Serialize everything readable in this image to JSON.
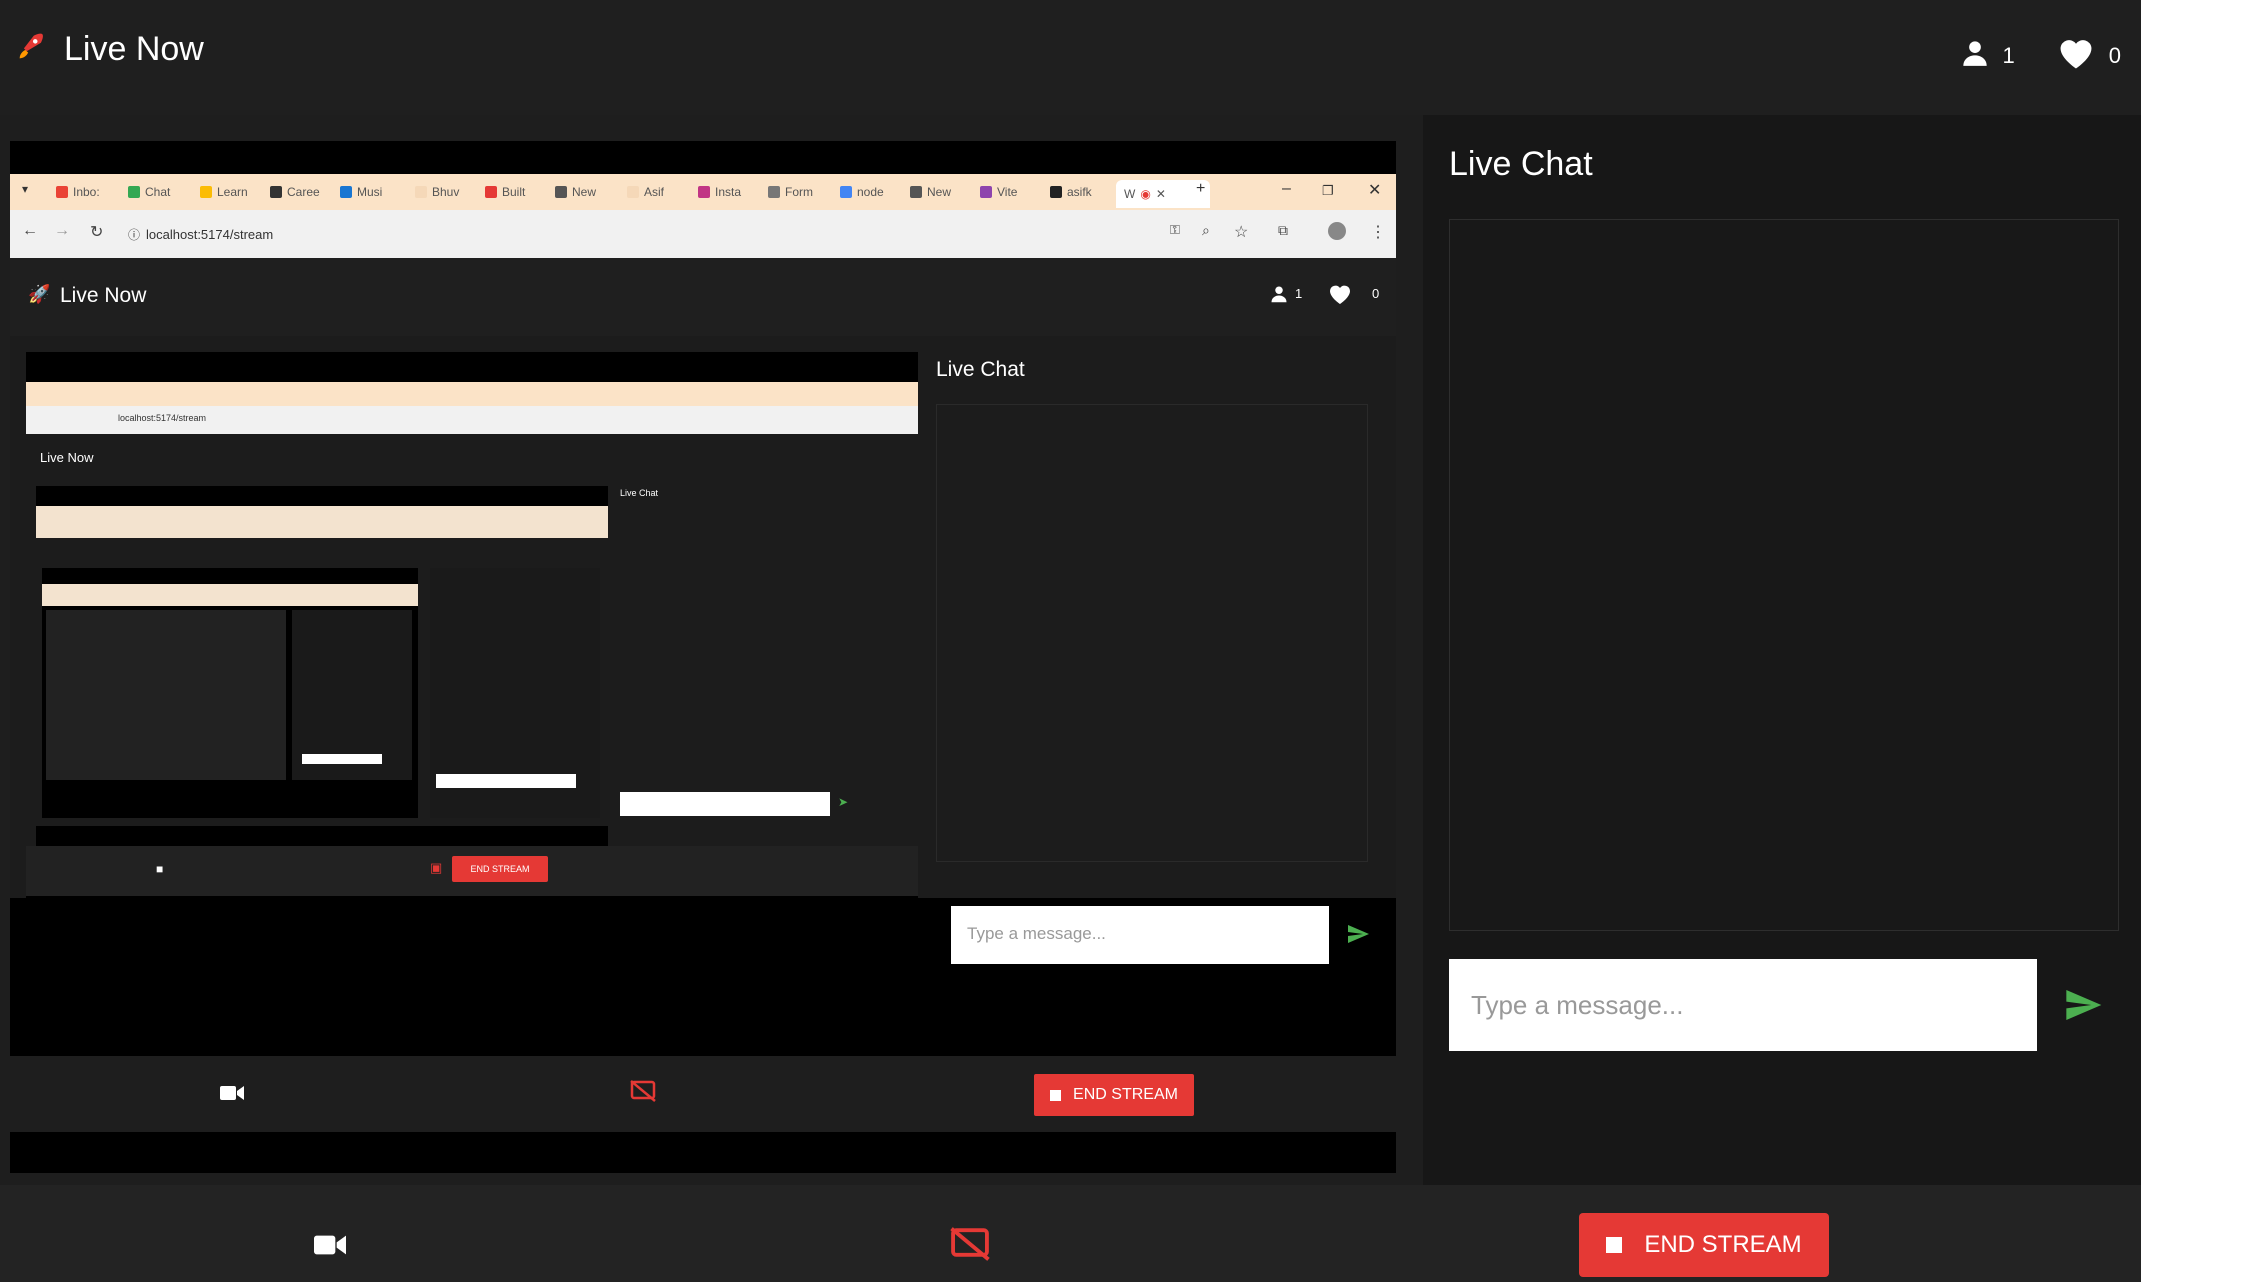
{
  "app": {
    "title": "Live Now",
    "viewer_count": "1",
    "like_count": "0",
    "logo_icon": "rocket-icon"
  },
  "chat": {
    "title": "Live Chat",
    "input_placeholder": "Type a message...",
    "send_icon": "send-icon"
  },
  "controls": {
    "camera_icon": "video-camera-icon",
    "screen_share_icon": "screen-share-off-icon",
    "end_label": "END STREAM"
  },
  "stream": {
    "browser": {
      "url": "localhost:5174/stream",
      "tabs": [
        "Inbo:",
        "Chat",
        "Learn",
        "Caree",
        "Musi",
        "Bhuv",
        "Built",
        "New",
        "Asif",
        "Insta",
        "Form",
        "node",
        "New",
        "Vite",
        "asifk",
        "W"
      ]
    },
    "title": "Live Now",
    "viewer_count": "1",
    "like_count": "0",
    "chat_title": "Live Chat",
    "input_placeholder": "Type a message...",
    "end_label": "END STREAM"
  },
  "colors": {
    "background": "#1e1e1e",
    "accent_red": "#e53935",
    "send_green": "#4caf50",
    "tab_bar": "#fbe3c7"
  }
}
